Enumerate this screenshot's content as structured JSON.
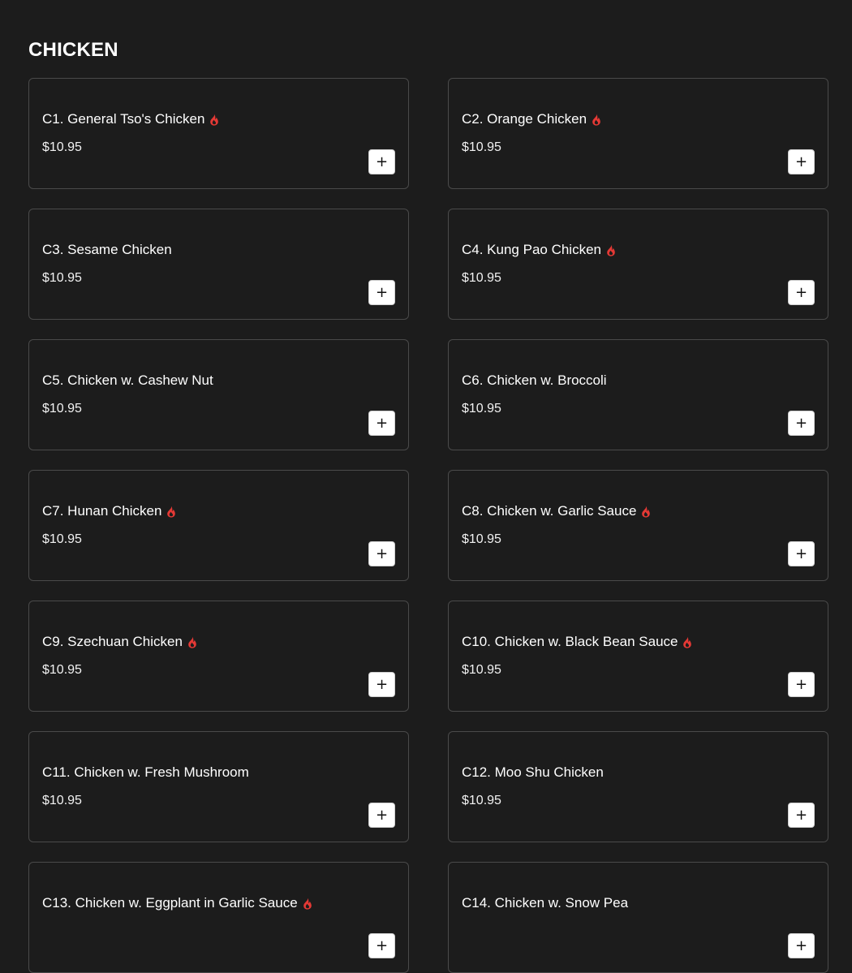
{
  "section": {
    "title": "CHICKEN"
  },
  "colors": {
    "background": "#1c1c1c",
    "card_border": "#4a4a4a",
    "spicy": "#e53935",
    "text": "#ffffff"
  },
  "add_button": {
    "label": "+",
    "icon": "plus-icon"
  },
  "spicy_icon": "flame-icon",
  "items": [
    {
      "name": "C1. General Tso's Chicken",
      "price": "$10.95",
      "spicy": true
    },
    {
      "name": "C2. Orange Chicken",
      "price": "$10.95",
      "spicy": true
    },
    {
      "name": "C3. Sesame Chicken",
      "price": "$10.95",
      "spicy": false
    },
    {
      "name": "C4. Kung Pao Chicken",
      "price": "$10.95",
      "spicy": true
    },
    {
      "name": "C5. Chicken w. Cashew Nut",
      "price": "$10.95",
      "spicy": false
    },
    {
      "name": "C6. Chicken w. Broccoli",
      "price": "$10.95",
      "spicy": false
    },
    {
      "name": "C7. Hunan Chicken",
      "price": "$10.95",
      "spicy": true
    },
    {
      "name": "C8. Chicken w. Garlic Sauce",
      "price": "$10.95",
      "spicy": true
    },
    {
      "name": "C9. Szechuan Chicken",
      "price": "$10.95",
      "spicy": true
    },
    {
      "name": "C10. Chicken w. Black Bean Sauce",
      "price": "$10.95",
      "spicy": true
    },
    {
      "name": "C11. Chicken w. Fresh Mushroom",
      "price": "$10.95",
      "spicy": false
    },
    {
      "name": "C12. Moo Shu Chicken",
      "price": "$10.95",
      "spicy": false
    },
    {
      "name": "C13. Chicken w. Eggplant in Garlic Sauce",
      "price": "",
      "spicy": true
    },
    {
      "name": "C14. Chicken w. Snow Pea",
      "price": "",
      "spicy": false
    }
  ]
}
